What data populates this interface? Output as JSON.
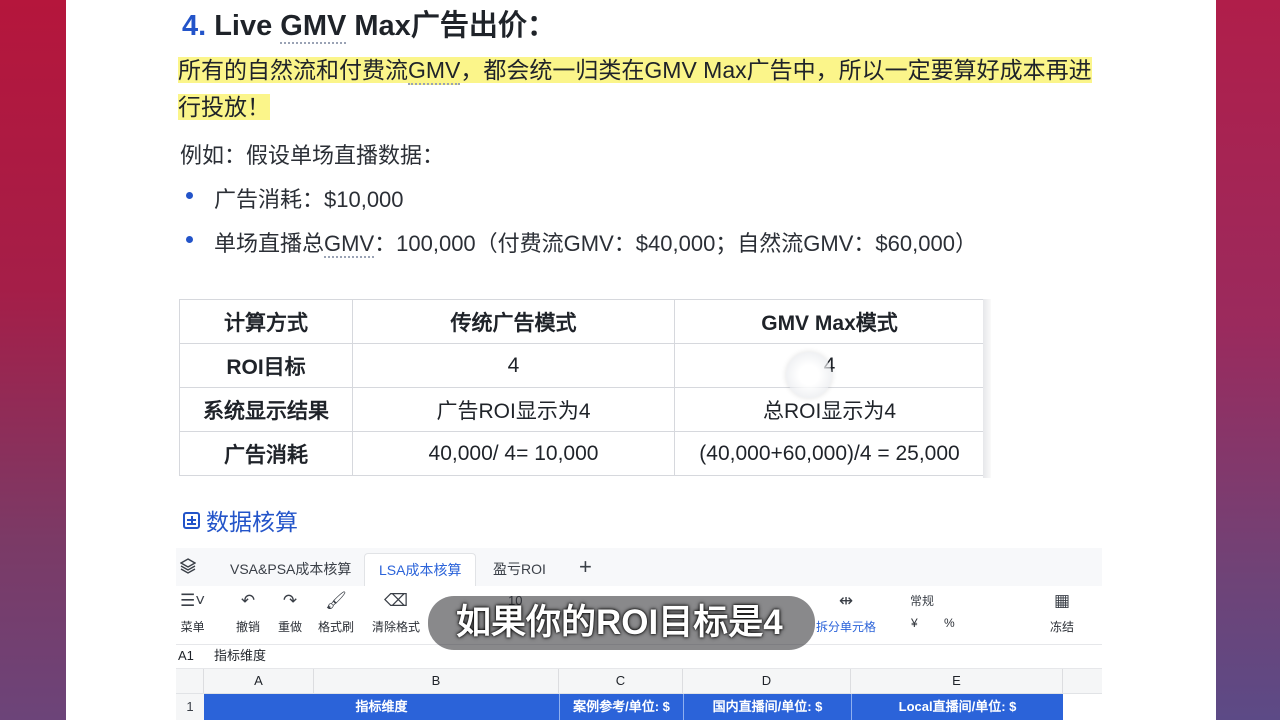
{
  "heading": {
    "number": "4.",
    "title_pre": "Live ",
    "title_gmv": "GMV",
    "title_post": " Max广告出价："
  },
  "highlight": {
    "pre": "所有的自然流和付费流",
    "gmv": "GMV",
    "post": "，都会统一归类在GMV Max广告中，所以一定要算好成本再进行投放！"
  },
  "example_intro": "例如：假设单场直播数据：",
  "bullets": [
    {
      "text": "广告消耗：$10,000"
    },
    {
      "pre": "单场直播总",
      "gmv": "GMV",
      "post": "：100,000（付费流GMV：$40,000；自然流GMV：$60,000）"
    }
  ],
  "table": {
    "headers": [
      "计算方式",
      "传统广告模式",
      "GMV Max模式"
    ],
    "rows": [
      [
        "ROI目标",
        "4",
        "4"
      ],
      [
        "系统显示结果",
        "广告ROI显示为4",
        "总ROI显示为4"
      ],
      [
        "广告消耗",
        "40,000/ 4= 10,000",
        "(40,000+60,000)/4 = 25,000"
      ]
    ]
  },
  "data_link": "数据核算",
  "sheet": {
    "tabs": [
      "VSA&PSA成本核算",
      "LSA成本核算",
      "盈亏ROI"
    ],
    "active_tab": 1,
    "toolbar": {
      "menu": "菜单",
      "undo": "撤销",
      "redo": "重做",
      "format_painter": "格式刷",
      "clear_format": "清除格式",
      "font_size": "10",
      "split_cells": "拆分单元格",
      "number_format": "常规",
      "currency": "¥",
      "percent": "%",
      "freeze": "冻结"
    },
    "cell_ref": "A1",
    "formula_value": "指标维度",
    "columns": [
      "A",
      "B",
      "C",
      "D",
      "E"
    ],
    "row_number": "1",
    "row1": [
      "指标维度",
      "案例参考/单位: $",
      "国内直播间/单位: $",
      "Local直播间/单位: $"
    ]
  },
  "subtitle": "如果你的ROI目标是4",
  "colors": {
    "accent": "#2354c9",
    "highlight": "#fbf58a",
    "sheet_header": "#2b63d9"
  }
}
